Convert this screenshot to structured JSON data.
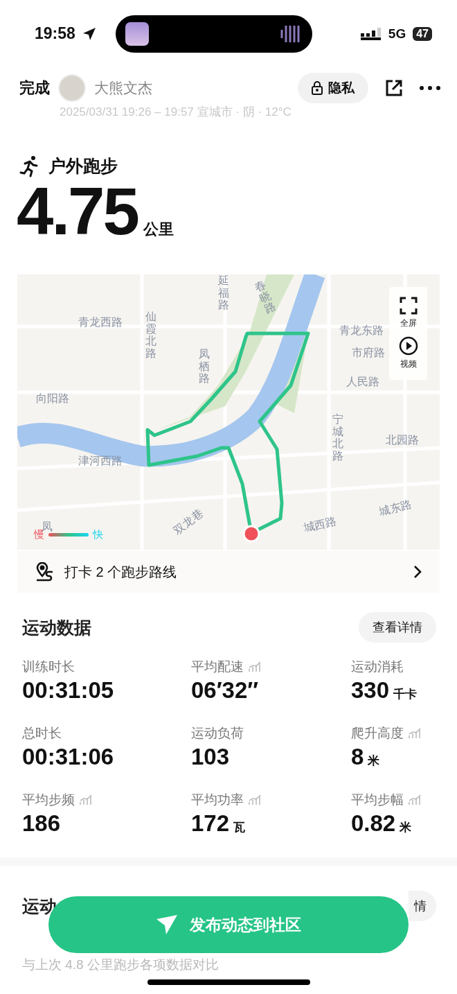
{
  "status_bar": {
    "time": "19:58",
    "network": "5G",
    "battery": "47"
  },
  "header": {
    "done": "完成",
    "user": "大熊文杰",
    "privacy": "隐私"
  },
  "meta": "2025/03/31 19:26 – 19:57 宣城市 · 阴 · 12°C",
  "workout": {
    "type": "户外跑步",
    "distance": "4.75",
    "unit": "公里"
  },
  "map": {
    "labels": [
      {
        "text": "延福路"
      },
      {
        "text": "春晓路"
      },
      {
        "text": "仙霞北路"
      },
      {
        "text": "青龙西路"
      },
      {
        "text": "青龙东路"
      },
      {
        "text": "市府路"
      },
      {
        "text": "人民路"
      },
      {
        "text": "凤栖路"
      },
      {
        "text": "向阳路"
      },
      {
        "text": "宁城北路"
      },
      {
        "text": "北园路"
      },
      {
        "text": "津河西路"
      },
      {
        "text": "双龙巷"
      },
      {
        "text": "城西路"
      },
      {
        "text": "城东路"
      },
      {
        "text": "凤"
      }
    ],
    "controls": [
      {
        "kind": "fullscreen",
        "label": "全屏"
      },
      {
        "kind": "video",
        "label": "视频"
      }
    ],
    "legend": {
      "slow": "慢",
      "fast": "快"
    },
    "checkin": "打卡 2 个跑步路线"
  },
  "stats": {
    "title": "运动数据",
    "details": "查看详情",
    "items": [
      {
        "label": "训练时长",
        "value": "00:31:05",
        "chart_icon": false
      },
      {
        "label": "平均配速",
        "value": "06′32″",
        "chart_icon": true
      },
      {
        "label": "运动消耗",
        "value": "330",
        "unit": "千卡",
        "chart_icon": false
      },
      {
        "label": "总时长",
        "value": "00:31:06",
        "chart_icon": false
      },
      {
        "label": "运动负荷",
        "value": "103",
        "chart_icon": false
      },
      {
        "label": "爬升高度",
        "value": "8",
        "unit": "米",
        "chart_icon": true
      },
      {
        "label": "平均步频",
        "value": "186",
        "chart_icon": true
      },
      {
        "label": "平均功率",
        "value": "172",
        "unit": "瓦",
        "chart_icon": true
      },
      {
        "label": "平均步幅",
        "value": "0.82",
        "unit": "米",
        "chart_icon": true
      }
    ]
  },
  "next_section": {
    "title": "运动",
    "details": "情",
    "subtitle": "与上次 4.8 公里跑步各项数据对比"
  },
  "publish_button": "发布动态到社区"
}
